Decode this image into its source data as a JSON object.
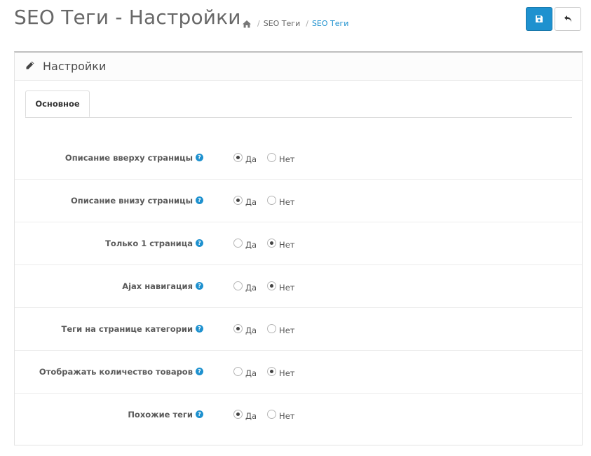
{
  "header": {
    "title": "SEO Теги - Настройки",
    "breadcrumb": {
      "home_icon": "home-icon",
      "items": [
        "SEO Теги",
        "SEO Теги"
      ]
    },
    "buttons": {
      "save_icon": "floppy-disk-icon",
      "back_icon": "reply-arrow-icon"
    }
  },
  "panel": {
    "icon": "pencil-icon",
    "title": "Настройки",
    "tabs": [
      {
        "label": "Основное",
        "active": true
      }
    ]
  },
  "options": {
    "yes": "Да",
    "no": "Нет"
  },
  "settings": [
    {
      "label": "Описание вверху страницы",
      "selected": "yes"
    },
    {
      "label": "Описание внизу страницы",
      "selected": "yes"
    },
    {
      "label": "Только 1 страница",
      "selected": "no"
    },
    {
      "label": "Ajax навигация",
      "selected": "no"
    },
    {
      "label": "Теги на странице категории",
      "selected": "yes"
    },
    {
      "label": "Отображать количество товаров",
      "selected": "no"
    },
    {
      "label": "Похожие теги",
      "selected": "yes"
    }
  ],
  "colors": {
    "primary": "#1e91cf",
    "title": "#686868"
  }
}
